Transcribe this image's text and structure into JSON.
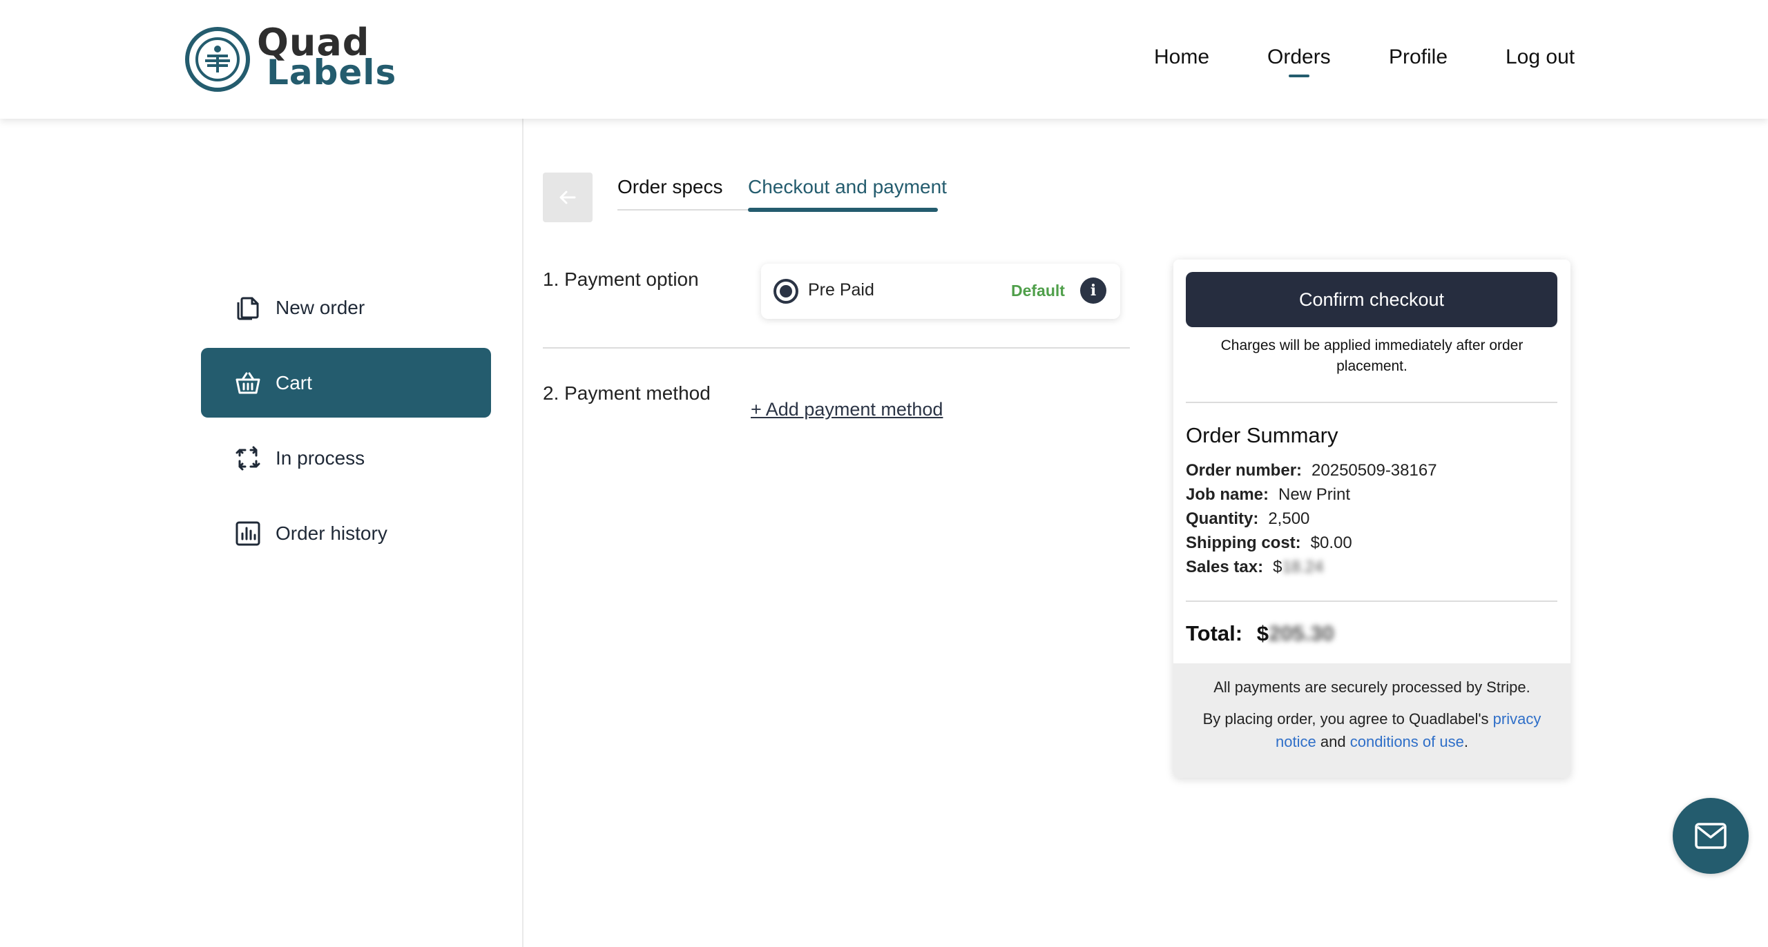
{
  "brand": {
    "line1": "Quad",
    "line2": "Labels"
  },
  "topnav": {
    "home": "Home",
    "orders": "Orders",
    "profile": "Profile",
    "logout": "Log out",
    "active": "Orders"
  },
  "sidebar": {
    "items": [
      {
        "label": "New order",
        "icon": "document-copy-icon"
      },
      {
        "label": "Cart",
        "icon": "basket-icon",
        "active": true
      },
      {
        "label": "In process",
        "icon": "process-arrows-icon"
      },
      {
        "label": "Order history",
        "icon": "bar-chart-icon"
      }
    ]
  },
  "tabs": {
    "order_specs": "Order specs",
    "checkout": "Checkout and payment",
    "active": "Checkout and payment"
  },
  "payment": {
    "option_title": "1. Payment option",
    "option_label": "Pre Paid",
    "option_default": "Default",
    "method_title": "2. Payment method",
    "add_method": "+ Add payment method"
  },
  "summary": {
    "confirm_label": "Confirm checkout",
    "charges_note": "Charges will be applied immediately after order placement.",
    "title": "Order Summary",
    "order_number_label": "Order number:",
    "order_number": "20250509-38167",
    "job_name_label": "Job name:",
    "job_name": "New Print",
    "quantity_label": "Quantity:",
    "quantity": "2,500",
    "shipping_label": "Shipping cost:",
    "shipping": "$0.00",
    "sales_tax_label": "Sales tax:",
    "sales_tax_currency": "$",
    "sales_tax_hidden": "18.24",
    "total_label": "Total:",
    "total_currency": "$",
    "total_hidden": "205.30",
    "secure_note": "All payments are securely processed by Stripe.",
    "agree_prefix": "By placing order, you agree to Quadlabel's",
    "privacy_link": "privacy notice",
    "and": "and",
    "conditions_link": "conditions of use",
    "period": "."
  },
  "colors": {
    "brand_teal": "#245c6e",
    "dark_button": "#262d3f",
    "default_green": "#4f9f4a",
    "link_blue": "#2f6fc8"
  }
}
